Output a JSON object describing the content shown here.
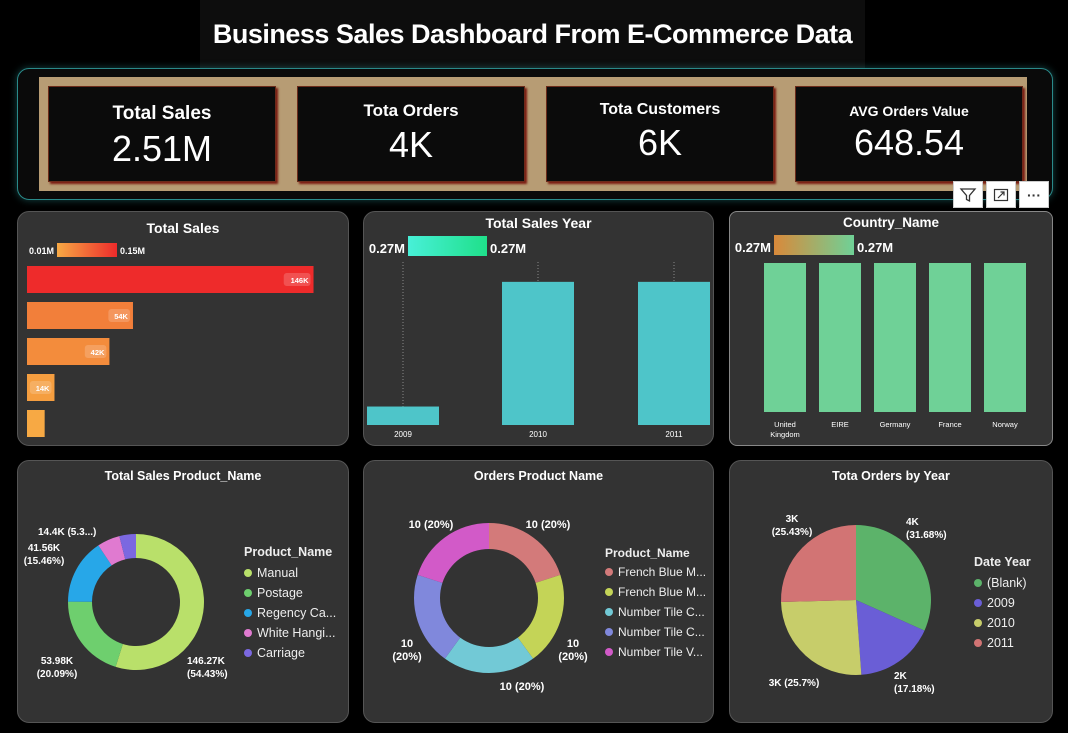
{
  "title": "Business Sales Dashboard From E-Commerce Data",
  "kpis": [
    {
      "label": "Total Sales",
      "value": "2.51M"
    },
    {
      "label": "Tota Orders",
      "value": "4K"
    },
    {
      "label": "Tota Customers",
      "value": "6K"
    },
    {
      "label": "AVG Orders Value",
      "value": "648.54"
    }
  ],
  "toolbar": {
    "filter_icon": "filter-icon",
    "focus_icon": "focus-mode-icon",
    "more_icon": "more-options-icon",
    "more_label": "···"
  },
  "colors": {
    "bg": "#000000",
    "card": "#333333",
    "kpi_strip": "#b79c74",
    "teal": "#4ec5c9",
    "green": "#6fd197"
  },
  "chart_data": [
    {
      "id": "total-sales",
      "type": "bar",
      "orientation": "horizontal",
      "title": "Total Sales",
      "gradient_legend": {
        "min_label": "0.01M",
        "max_label": "0.15M",
        "from": "#f7a944",
        "to": "#ee2b2b"
      },
      "values": [
        146,
        54,
        42,
        14,
        9
      ],
      "data_labels": [
        "146K",
        "54K",
        "42K",
        "14K",
        ""
      ],
      "colors": [
        "#ee2b2b",
        "#f27f3a",
        "#f38c3c",
        "#f59e40",
        "#f7a944"
      ],
      "xlim": [
        0,
        160
      ]
    },
    {
      "id": "total-sales-year",
      "type": "bar",
      "title": "Total Sales Year",
      "gradient_legend": {
        "min_label": "0.27M",
        "max_label": "0.27M",
        "from": "#48f0d8",
        "to": "#1fe08a"
      },
      "categories": [
        "2009",
        "2010",
        "2011"
      ],
      "values": [
        0.04,
        0.31,
        0.31
      ],
      "ylim": [
        0,
        0.34
      ],
      "color": "#4ec5c9"
    },
    {
      "id": "country-name",
      "type": "bar",
      "title": "Country_Name",
      "gradient_legend": {
        "min_label": "0.27M",
        "max_label": "0.27M",
        "from": "#d9893a",
        "to": "#6fd197"
      },
      "categories": [
        "United Kingdom",
        "EIRE",
        "Germany",
        "France",
        "Norway"
      ],
      "values": [
        0.27,
        0.27,
        0.27,
        0.27,
        0.27
      ],
      "ylim": [
        0,
        0.27
      ],
      "color": "#6fd197"
    },
    {
      "id": "total-sales-product",
      "type": "pie",
      "donut": true,
      "title": "Total Sales Product_Name",
      "legend_title": "Product_Name",
      "labels": [
        "Manual",
        "Postage",
        "Regency Ca...",
        "White Hangi...",
        "Carriage"
      ],
      "values": [
        146.27,
        53.98,
        41.56,
        14.4,
        10.5
      ],
      "colors": [
        "#b9e06a",
        "#6ecf6e",
        "#27a7e8",
        "#e07ad0",
        "#7b68e0"
      ],
      "data_labels": [
        [
          "146.27K",
          "(54.43%)"
        ],
        [
          "53.98K",
          "(20.09%)"
        ],
        [
          "41.56K",
          "(15.46%)"
        ],
        [
          "14.4K (5.3...)"
        ],
        []
      ]
    },
    {
      "id": "orders-product",
      "type": "pie",
      "donut": true,
      "title": "Orders Product Name",
      "legend_title": "Product_Name",
      "labels": [
        "French Blue M...",
        "French Blue M...",
        "Number Tile C...",
        "Number Tile C...",
        "Number Tile V..."
      ],
      "values": [
        10,
        10,
        10,
        10,
        10
      ],
      "colors": [
        "#d37a7a",
        "#c4d457",
        "#72c9d6",
        "#8088dc",
        "#d25ac8"
      ],
      "data_labels": [
        [
          "10 (20%)"
        ],
        [
          "10",
          "(20%)"
        ],
        [
          "10 (20%)"
        ],
        [
          "10",
          "(20%)"
        ],
        [
          "10 (20%)"
        ]
      ]
    },
    {
      "id": "orders-by-year",
      "type": "pie",
      "donut": false,
      "title": "Tota Orders by Year",
      "legend_title": "Date Year",
      "labels": [
        "(Blank)",
        "2009",
        "2010",
        "2011"
      ],
      "values": [
        31.68,
        17.18,
        25.7,
        25.43
      ],
      "colors": [
        "#5cb36a",
        "#6a5ed6",
        "#c7cd6a",
        "#d27474"
      ],
      "data_labels": [
        [
          "4K",
          "(31.68%)"
        ],
        [
          "2K",
          "(17.18%)"
        ],
        [
          "3K (25.7%)"
        ],
        [
          "3K",
          "(25.43%)"
        ]
      ]
    }
  ]
}
